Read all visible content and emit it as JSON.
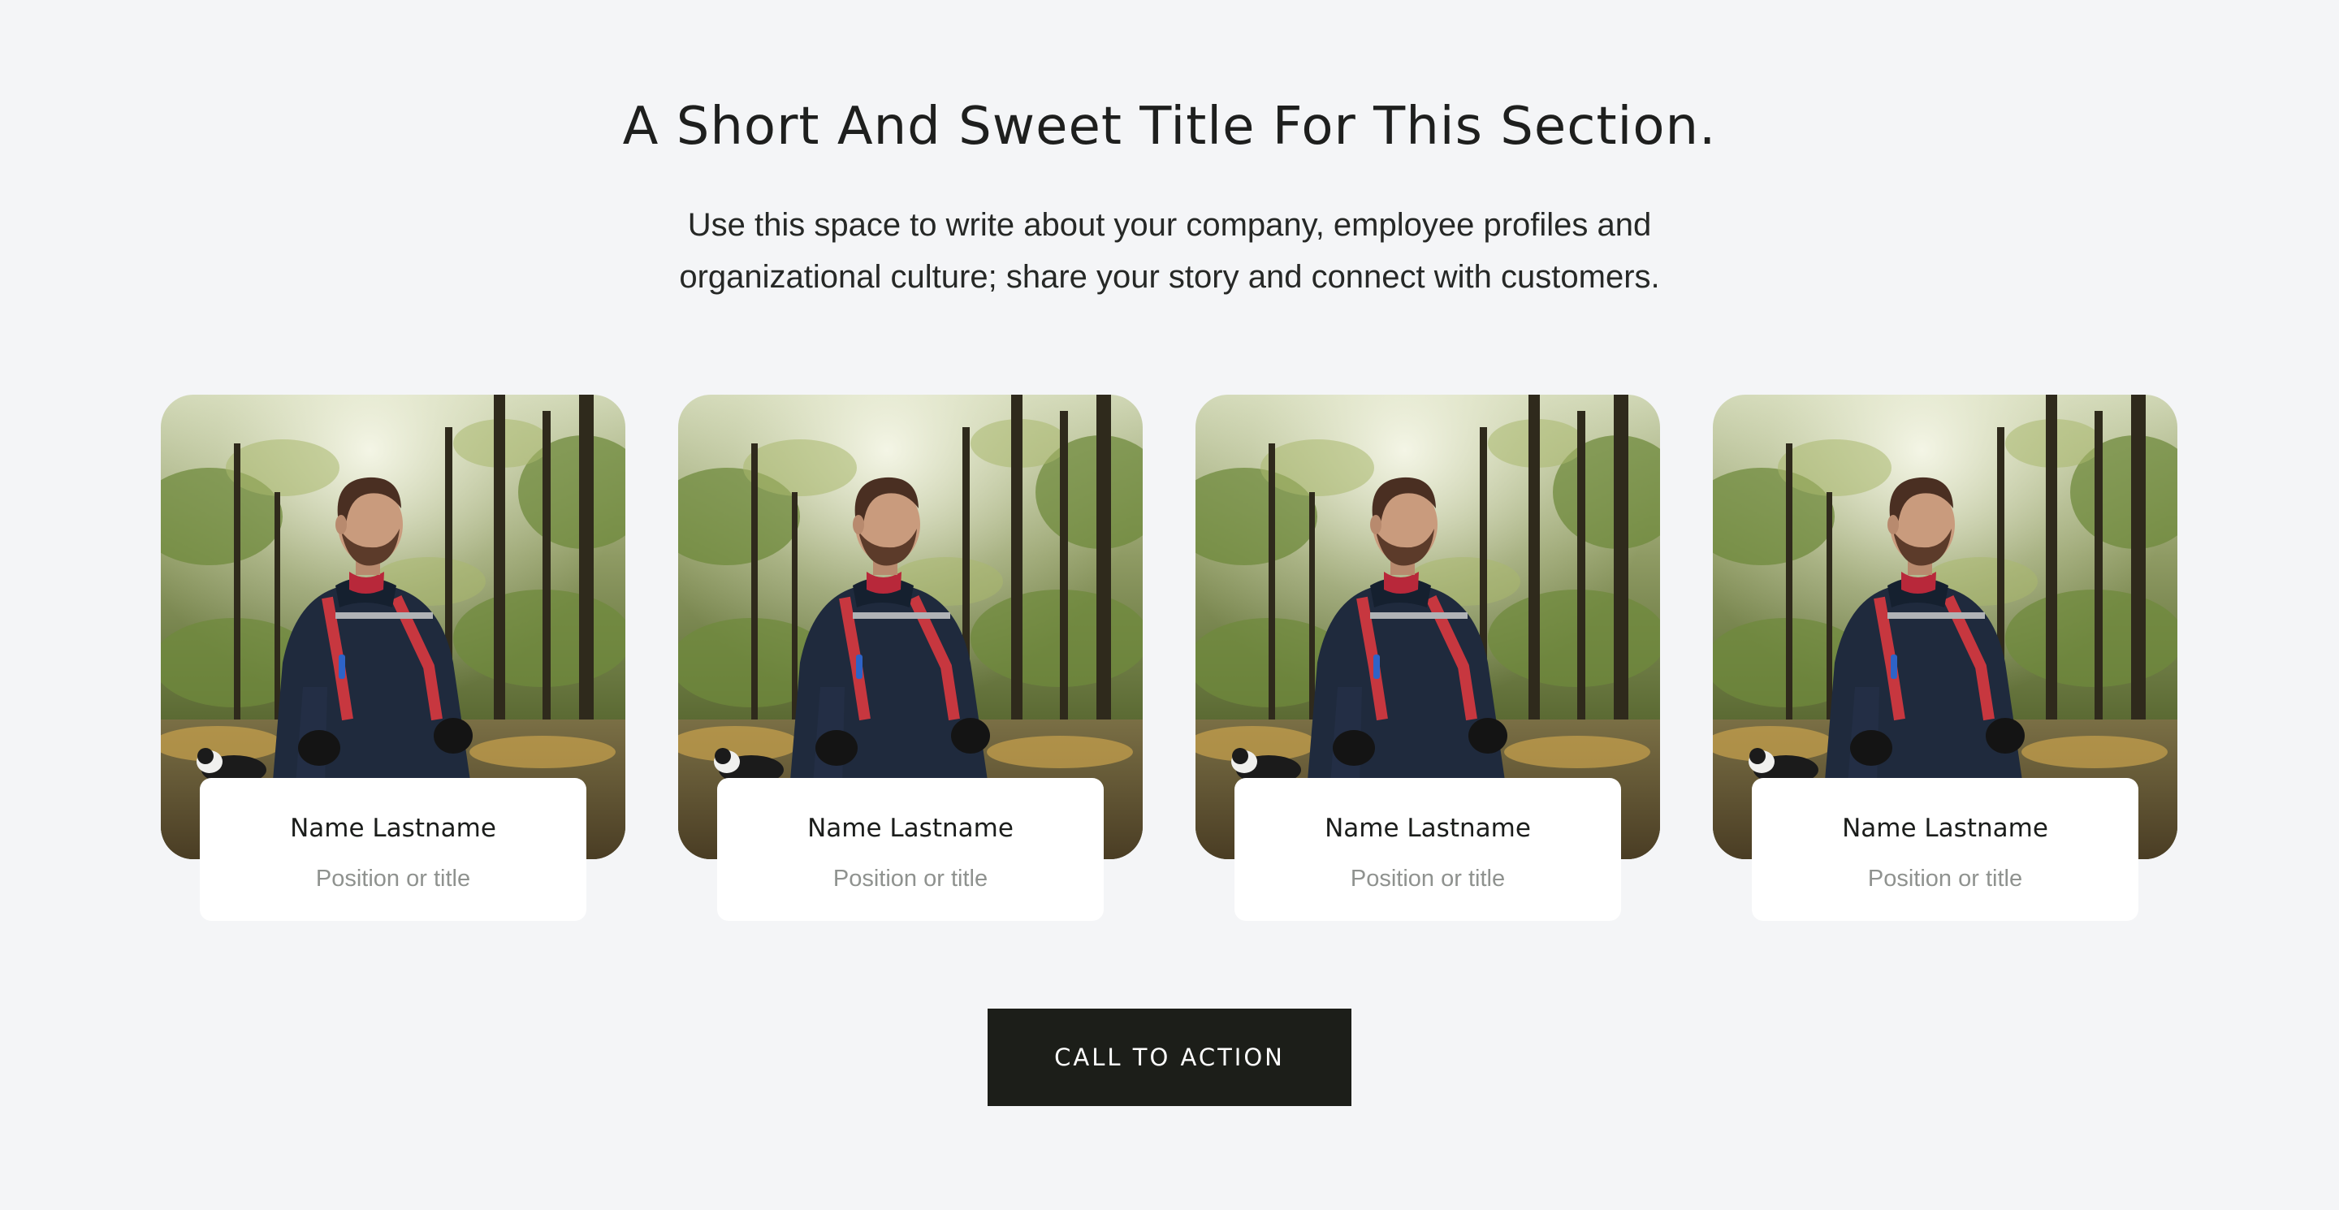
{
  "section": {
    "title": "A Short And Sweet Title For This Section.",
    "intro_line1": "Use this space to write about your company, employee profiles and",
    "intro_line2": "organizational culture; share your story and connect with customers."
  },
  "team": [
    {
      "name": "Name Lastname",
      "position": "Position or title",
      "photo": "hiker-in-forest-photo"
    },
    {
      "name": "Name Lastname",
      "position": "Position or title",
      "photo": "hiker-in-forest-photo"
    },
    {
      "name": "Name Lastname",
      "position": "Position or title",
      "photo": "hiker-in-forest-photo"
    },
    {
      "name": "Name Lastname",
      "position": "Position or title",
      "photo": "hiker-in-forest-photo"
    }
  ],
  "cta": {
    "label": "CALL TO ACTION"
  },
  "colors": {
    "background": "#f4f5f7",
    "card": "#ffffff",
    "cta_background": "#1c1e19",
    "cta_text": "#ffffff",
    "text_primary": "#1b1d1b",
    "text_muted": "#8f928f"
  }
}
